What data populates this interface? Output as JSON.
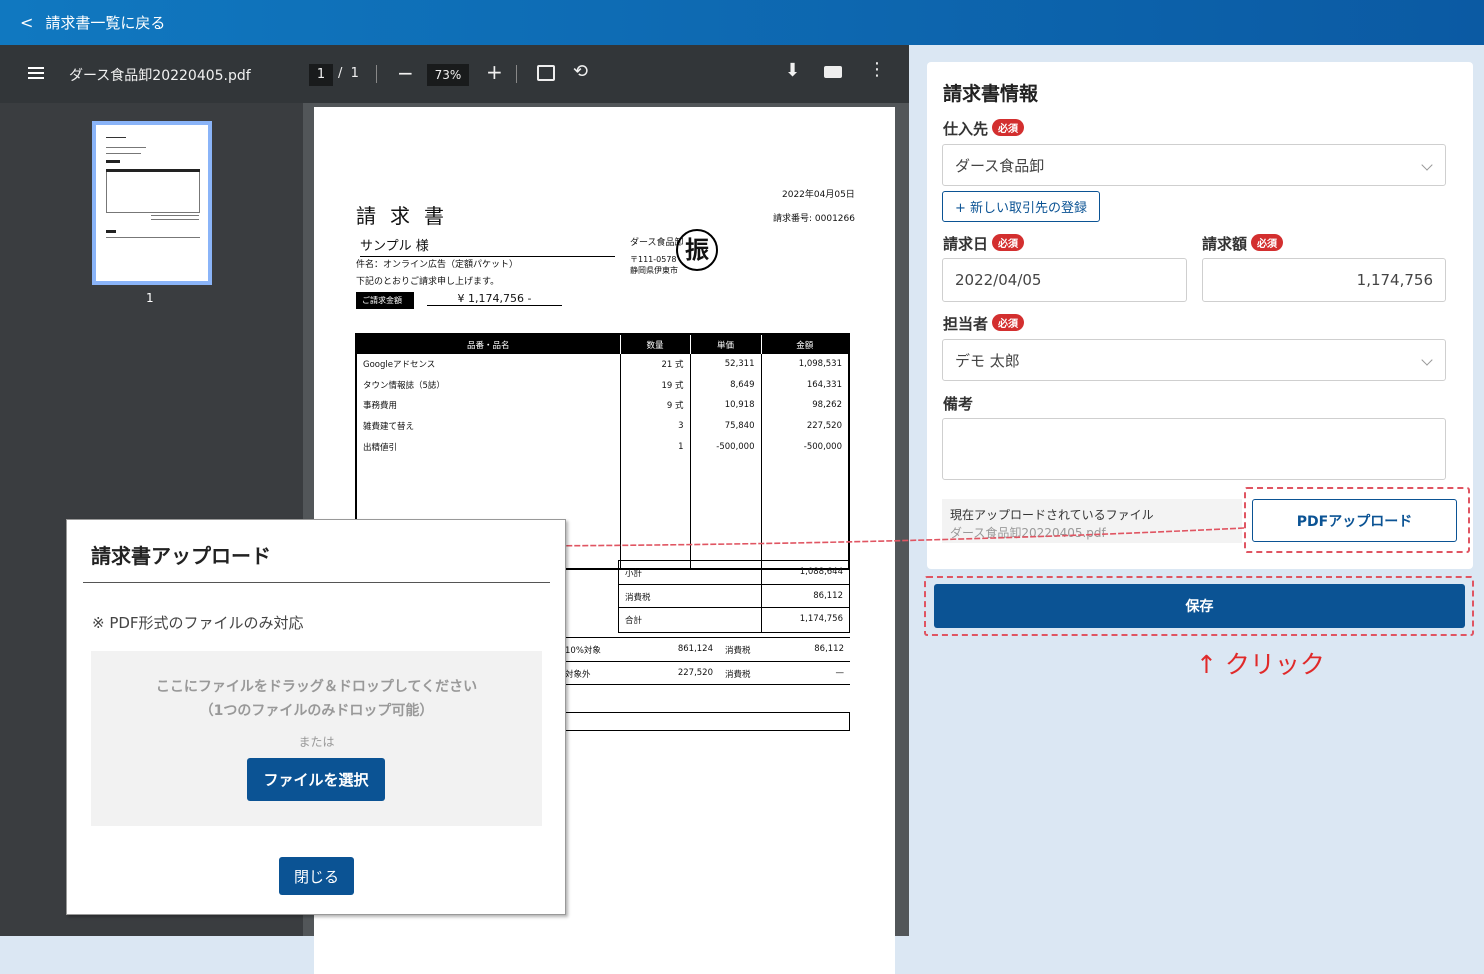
{
  "header": {
    "back_icon": "chevron-left-icon",
    "back_label": "請求書一覧に戻る"
  },
  "viewer": {
    "filename": "ダース食品卸20220405.pdf",
    "page_current": "1",
    "page_sep": "/",
    "page_total": "1",
    "zoom": "73%",
    "zoom_minus": "−",
    "zoom_plus": "+",
    "rotate": "⟲",
    "download": "⬇",
    "more": "⋮",
    "thumb_label": "1"
  },
  "invoice": {
    "date": "2022年04月05日",
    "title": "請求書",
    "number": "請求番号: 0001266",
    "customer": "サンプル 様",
    "subject": "件名：オンライン広告（定額パケット）",
    "note": "下記のとおりご請求申し上げます。",
    "issuer": "ダース食品卸",
    "zip": "〒111-0578",
    "address": "静岡県伊東市",
    "stamp": "振",
    "amount_label": "ご請求金額",
    "amount": "¥ 1,174,756 -",
    "headers": [
      "品番・品名",
      "数量",
      "単価",
      "金額"
    ],
    "rows": [
      [
        "Googleアドセンス",
        "21 式",
        "52,311",
        "1,098,531"
      ],
      [
        "タウン情報誌（5誌）",
        "19 式",
        "8,649",
        "164,331"
      ],
      [
        "事務費用",
        "9 式",
        "10,918",
        "98,262"
      ],
      [
        "雑費建て替え",
        "3",
        "75,840",
        "227,520"
      ],
      [
        "出精値引",
        "1",
        "-500,000",
        "-500,000"
      ]
    ],
    "subtotal_label": "小計",
    "subtotal": "1,088,644",
    "tax_label": "消費税",
    "tax": "86,112",
    "total_label": "合計",
    "total": "1,174,756",
    "tax_rows": [
      [
        "10%対象",
        "861,124",
        "消費税",
        "86,112"
      ],
      [
        "対象外",
        "227,520",
        "消費税",
        "—"
      ]
    ]
  },
  "form": {
    "title": "請求書情報",
    "required": "必須",
    "vendor_label": "仕入先",
    "vendor_value": "ダース食品卸",
    "new_vendor": "+ 新しい取引先の登録",
    "date_label": "請求日",
    "date_value": "2022/04/05",
    "amount_label": "請求額",
    "amount_value": "1,174,756",
    "person_label": "担当者",
    "person_value": "デモ 太郎",
    "memo_label": "備考",
    "file_label": "現在アップロードされているファイル",
    "file_name": "ダース食品卸20220405.pdf",
    "pdf_button": "PDFアップロード",
    "save_button": "保存"
  },
  "annotation": {
    "click_label": "↑ クリック",
    "color": "#e02a2a"
  },
  "modal": {
    "title": "請求書アップロード",
    "note": "※ PDF形式のファイルのみ対応",
    "drop_line1": "ここにファイルをドラッグ＆ドロップしてください",
    "drop_line2": "（1つのファイルのみドロップ可能）",
    "or": "または",
    "select_button": "ファイルを選択",
    "close_button": "閉じる"
  },
  "colors": {
    "primary": "#0b5394",
    "required_badge": "#d32f2f",
    "header_gradient_start": "#1078c0"
  }
}
